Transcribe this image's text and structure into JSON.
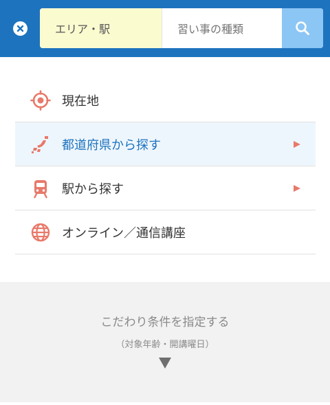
{
  "header": {
    "area_placeholder": "エリア・駅",
    "lesson_placeholder": "習い事の種類"
  },
  "menu": {
    "items": [
      {
        "label": "現在地",
        "icon": "location-target-icon"
      },
      {
        "label": "都道府県から探す",
        "icon": "japan-map-icon",
        "active": true
      },
      {
        "label": "駅から探す",
        "icon": "train-icon"
      },
      {
        "label": "オンライン／通信講座",
        "icon": "globe-icon"
      }
    ]
  },
  "filter": {
    "title": "こだわり条件を指定する",
    "subtitle": "（対象年齢・開講曜日）"
  },
  "colors": {
    "header_bg": "#1e73be",
    "area_field_bg": "#fbfbd0",
    "search_button_bg": "#8cc6f5",
    "icon_accent": "#e8796a",
    "active_text": "#1e73be",
    "active_bg": "#eef6fd"
  }
}
